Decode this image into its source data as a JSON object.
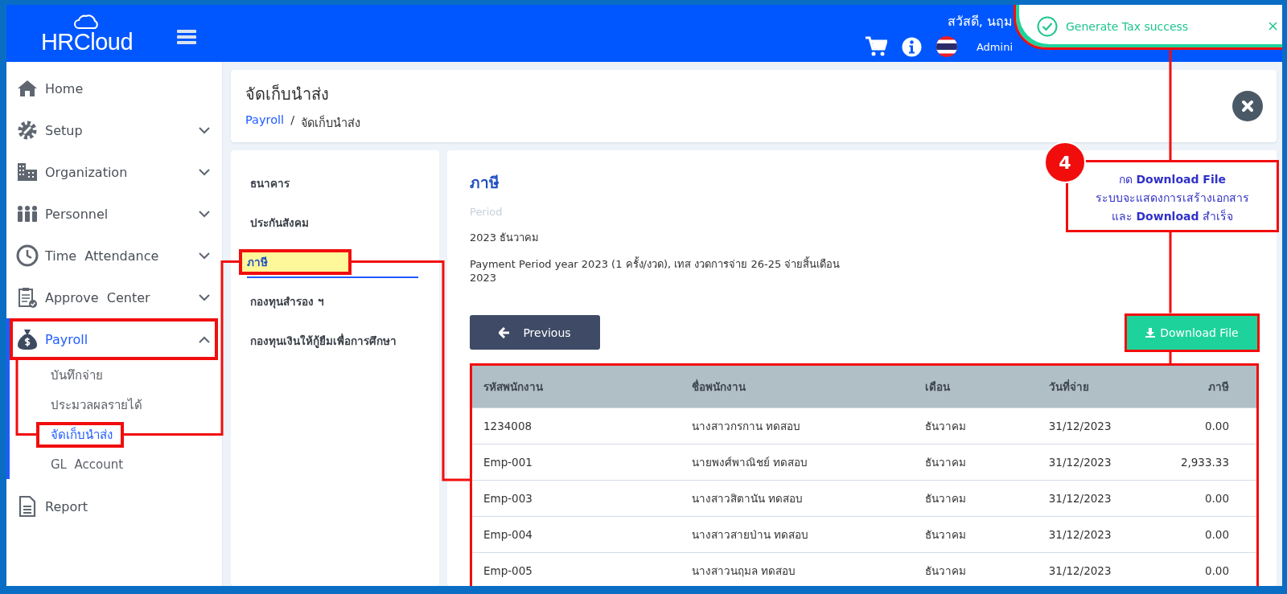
{
  "header": {
    "logo": "HRCloud",
    "greeting": "สวัสดี, นฤม",
    "user": "Admini"
  },
  "toast": {
    "message": "Generate Tax success"
  },
  "sidebar": {
    "items": [
      {
        "label": "Home",
        "selected": false
      },
      {
        "label": "Setup",
        "selected": false,
        "expanded": false
      },
      {
        "label": "Organization",
        "selected": false,
        "expanded": false
      },
      {
        "label": "Personnel",
        "selected": false,
        "expanded": false
      },
      {
        "label": "Time  Attendance",
        "selected": false,
        "expanded": false
      },
      {
        "label": "Approve  Center",
        "selected": false,
        "expanded": false
      },
      {
        "label": "Payroll",
        "selected": true,
        "expanded": true,
        "highlighted": true,
        "children": [
          {
            "label": "บันทึกจ่าย",
            "selected": false,
            "highlighted": false
          },
          {
            "label": "ประมวลผลรายได้",
            "selected": false,
            "highlighted": false
          },
          {
            "label": "จัดเก็บนำส่ง",
            "selected": true,
            "highlighted": true
          },
          {
            "label": "GL  Account",
            "selected": false,
            "highlighted": false
          }
        ]
      },
      {
        "label": "Report",
        "selected": false
      }
    ]
  },
  "page": {
    "title": "จัดเก็บนำส่ง",
    "breadcrumb": [
      {
        "label": "Payroll",
        "kind": "link"
      },
      {
        "label": "/",
        "kind": "separator"
      },
      {
        "label": "จัดเก็บนำส่ง",
        "kind": "current"
      }
    ]
  },
  "subnav": [
    {
      "label": "ธนาคาร",
      "selected": false,
      "highlighted": false
    },
    {
      "label": "ประกันสังคม",
      "selected": false,
      "highlighted": false
    },
    {
      "label": "ภาษี",
      "selected": true,
      "highlighted": true
    },
    {
      "label": "กองทุนสำรอง ฯ",
      "selected": false,
      "highlighted": false
    },
    {
      "label": "กองทุนเงินให้กู้ยืมเพื่อการศึกษา",
      "selected": false,
      "highlighted": false
    }
  ],
  "detail": {
    "title": "ภาษี",
    "period_label": "Period",
    "period": "2023 ธันวาคม",
    "description": "Payment Period year 2023 (1 ครั้ง/งวด), เทส งวดการจ่าย 26-25 จ่ายสิ้นเดือน 2023"
  },
  "actions": {
    "previous": {
      "label": "Previous"
    },
    "download": {
      "label": "Download File",
      "highlighted": true
    }
  },
  "table": {
    "highlighted": true,
    "columns": [
      "รหัสพนักงาน",
      "ชื่อพนักงาน",
      "เดือน",
      "วันที่จ่าย",
      "ภาษี"
    ],
    "rows": [
      [
        "1234008",
        "นางสาวกรกาน ทดสอบ",
        "ธันวาคม",
        "31/12/2023",
        "0.00"
      ],
      [
        "Emp-001",
        "นายพงศ์พาณิชย์ ทดสอบ",
        "ธันวาคม",
        "31/12/2023",
        "2,933.33"
      ],
      [
        "Emp-003",
        "นางสาวสิตานัน ทดสอบ",
        "ธันวาคม",
        "31/12/2023",
        "0.00"
      ],
      [
        "Emp-004",
        "นางสาวสายป่าน ทดสอบ",
        "ธันวาคม",
        "31/12/2023",
        "0.00"
      ],
      [
        "Emp-005",
        "นางสาวนฤมล ทดสอบ",
        "ธันวาคม",
        "31/12/2023",
        "0.00"
      ]
    ]
  },
  "callout": {
    "step": "4",
    "lines": [
      "กด **Download File**",
      "ระบบจะแสดงการเสร้างเอกสาร",
      "และ **Download** สำเร็จ"
    ]
  }
}
